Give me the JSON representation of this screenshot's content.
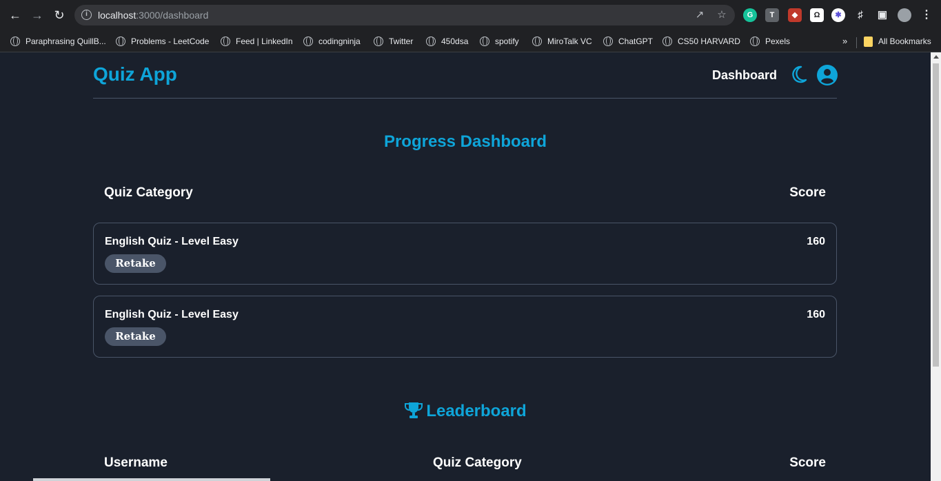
{
  "browser": {
    "url_host": "localhost",
    "url_path": ":3000/dashboard",
    "bookmarks": [
      "Paraphrasing QuillB...",
      "Problems - LeetCode",
      "Feed | LinkedIn",
      "codingninja",
      "Twitter",
      "450dsa",
      "spotify",
      "MiroTalk VC",
      "ChatGPT",
      "CS50 HARVARD",
      "Pexels"
    ],
    "all_bookmarks": "All Bookmarks",
    "more": "»"
  },
  "app": {
    "title": "Quiz App",
    "nav": {
      "dashboard": "Dashboard"
    }
  },
  "progress": {
    "title": "Progress Dashboard",
    "headers": {
      "category": "Quiz Category",
      "score": "Score"
    },
    "rows": [
      {
        "category": "English Quiz - Level Easy",
        "score": "160",
        "action": "Retake"
      },
      {
        "category": "English Quiz - Level Easy",
        "score": "160",
        "action": "Retake"
      }
    ]
  },
  "leaderboard": {
    "title": "Leaderboard",
    "headers": {
      "username": "Username",
      "category": "Quiz Category",
      "score": "Score"
    }
  },
  "colors": {
    "accent": "#0ea5d9",
    "background": "#1a202c",
    "button": "#4a5568"
  }
}
